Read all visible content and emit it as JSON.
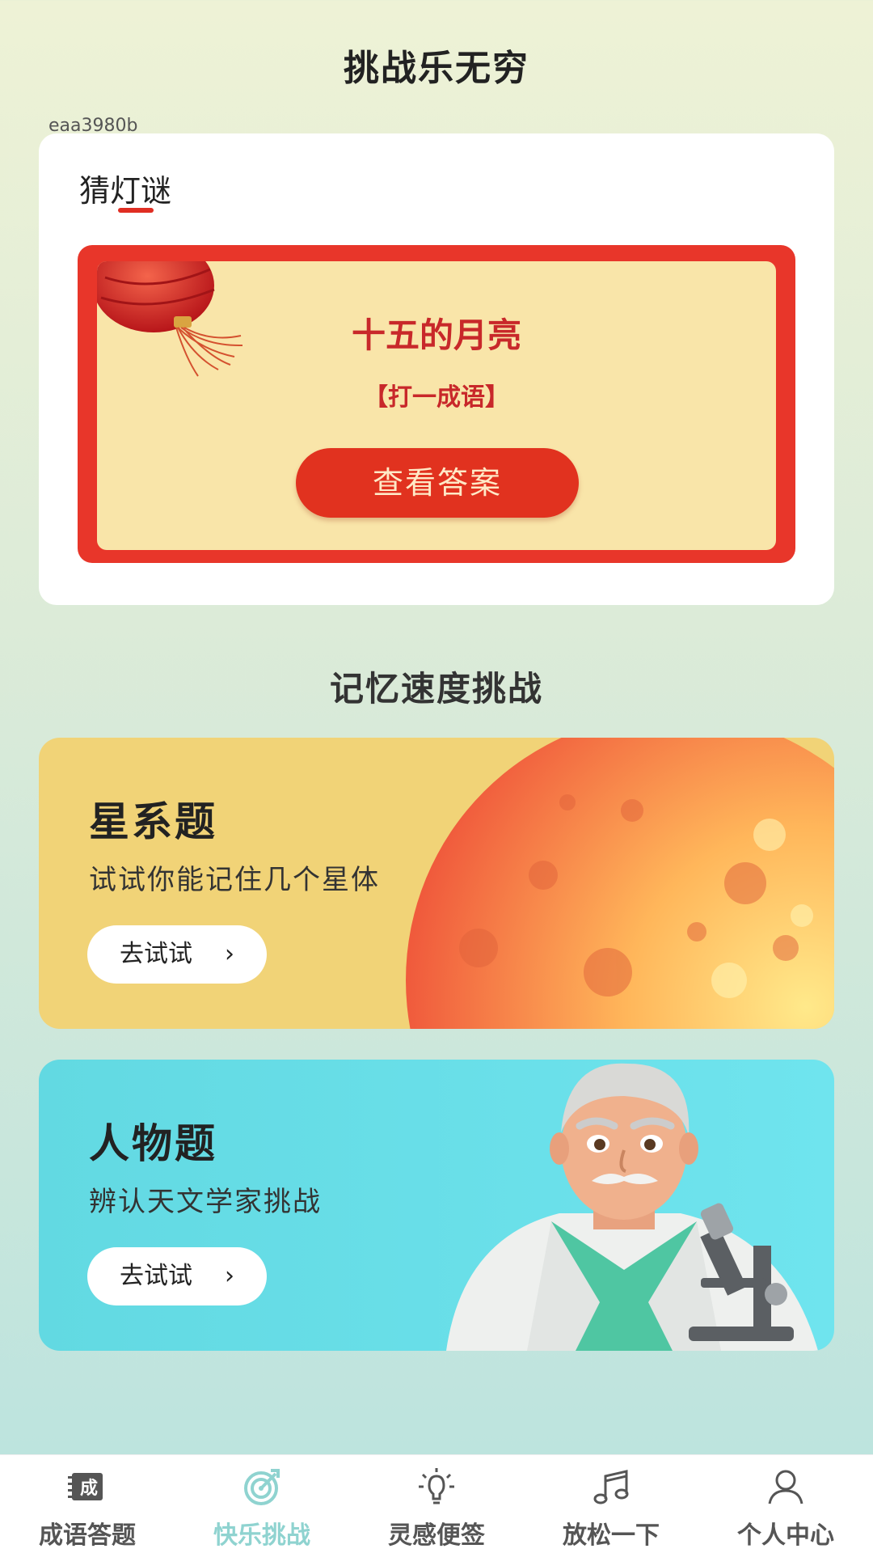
{
  "header": {
    "title": "挑战乐无穷"
  },
  "watermark": "eaa3980b",
  "riddle": {
    "tab_label": "猜灯谜",
    "question": "十五的月亮",
    "hint": "【打一成语】",
    "answer_button": "查看答案"
  },
  "memory": {
    "section_title": "记忆速度挑战",
    "cards": [
      {
        "title": "星系题",
        "subtitle": "试试你能记住几个星体",
        "button": "去试试",
        "chevron": "›"
      },
      {
        "title": "人物题",
        "subtitle": "辨认天文学家挑战",
        "button": "去试试",
        "chevron": "›"
      }
    ]
  },
  "tabbar": {
    "active_index": 1,
    "active_color": "#8fd3d0",
    "items": [
      {
        "label": "成语答题",
        "icon": "idiom-icon",
        "icon_text": "成"
      },
      {
        "label": "快乐挑战",
        "icon": "target-icon"
      },
      {
        "label": "灵感便签",
        "icon": "lightbulb-icon"
      },
      {
        "label": "放松一下",
        "icon": "music-note-icon"
      },
      {
        "label": "个人中心",
        "icon": "user-icon"
      }
    ]
  },
  "colors": {
    "accent_red": "#e1321f",
    "riddle_bg": "#f9e5a9",
    "star_card_bg": "#f1d377",
    "person_card_bg": "#6fe4ee"
  }
}
